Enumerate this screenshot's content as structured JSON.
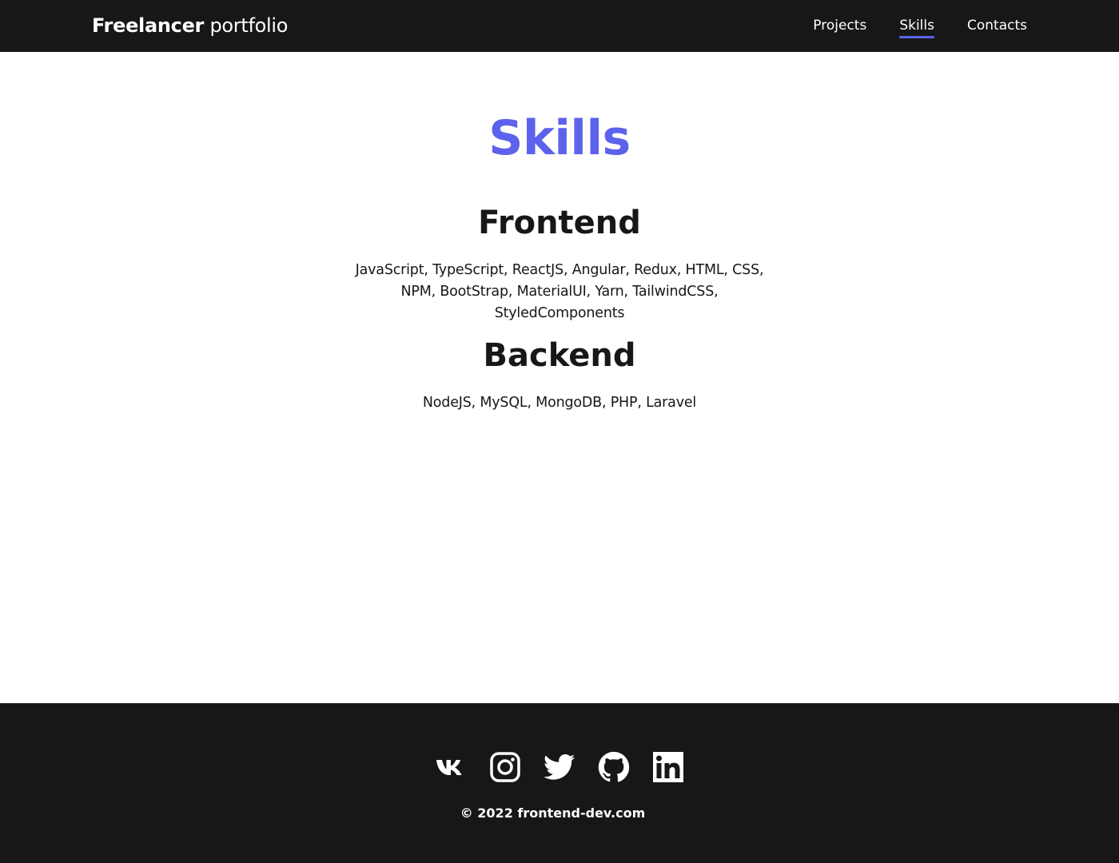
{
  "header": {
    "logo_bold": "Freelancer",
    "logo_light": "portfolio",
    "nav": [
      {
        "label": "Projects",
        "active": false
      },
      {
        "label": "Skills",
        "active": true
      },
      {
        "label": "Contacts",
        "active": false
      }
    ]
  },
  "main": {
    "title": "Skills",
    "sections": [
      {
        "heading": "Frontend",
        "text": "JavaScript, TypeScript, ReactJS, Angular, Redux, HTML, CSS, NPM, BootStrap, MaterialUI, Yarn, TailwindCSS, StyledComponents"
      },
      {
        "heading": "Backend",
        "text": "NodeJS, MySQL, MongoDB, PHP, Laravel"
      }
    ]
  },
  "footer": {
    "social_icons": [
      "vk-icon",
      "instagram-icon",
      "twitter-icon",
      "github-icon",
      "linkedin-icon"
    ],
    "copyright": "© 2022 frontend-dev.com"
  },
  "colors": {
    "accent": "#5c62ec",
    "dark": "#171718",
    "background": "#ffffff"
  }
}
